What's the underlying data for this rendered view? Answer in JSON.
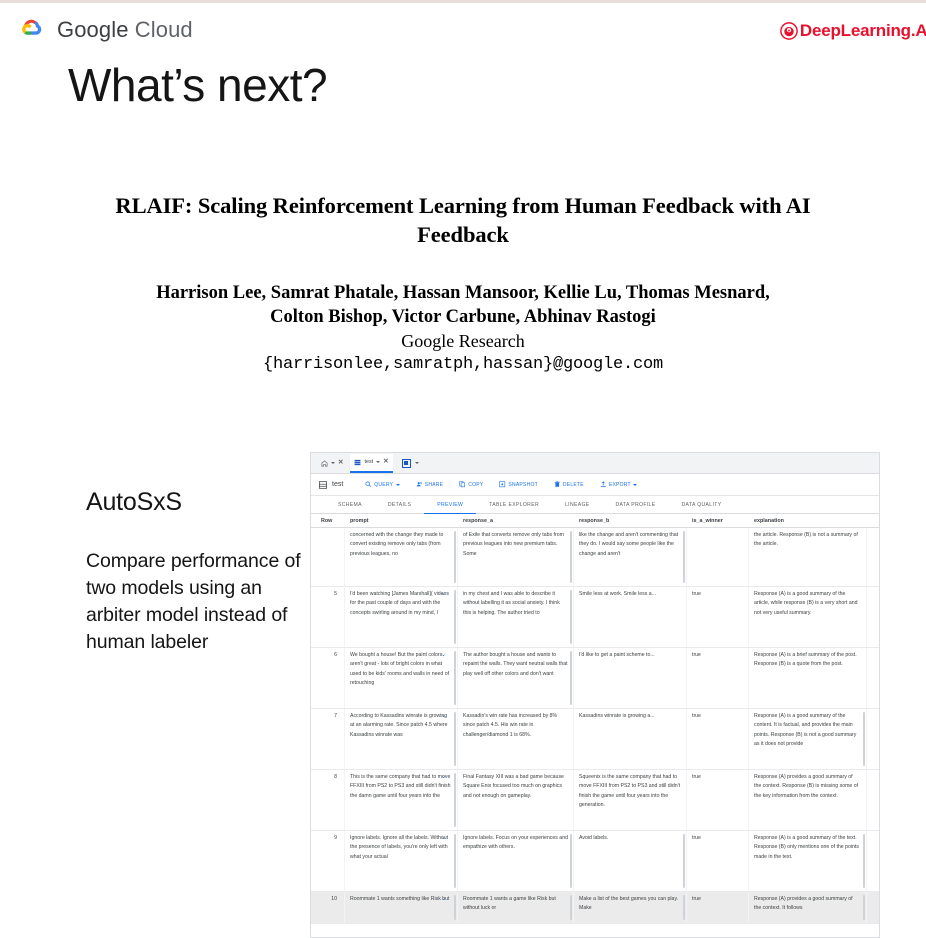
{
  "header": {
    "google_cloud_label_bold": "Google",
    "google_cloud_label_thin": "Cloud",
    "deeplearning_label": "DeepLearning.AI"
  },
  "slide": {
    "title": "What’s next?"
  },
  "paper": {
    "title": "RLAIF: Scaling Reinforcement Learning from Human Feedback with AI Feedback",
    "authors_line1": "Harrison Lee, Samrat Phatale, Hassan Mansoor, Kellie Lu, Thomas Mesnard,",
    "authors_line2": "Colton Bishop, Victor Carbune, Abhinav Rastogi",
    "affiliation": "Google Research",
    "email": "{harrisonlee,samratph,hassan}@google.com"
  },
  "left_column": {
    "heading": "AutoSxS",
    "body": "Compare performance of two models using an arbiter model instead of human labeler"
  },
  "console": {
    "tabstrip": {
      "home_tab_icon": "home-icon",
      "home_tab_caret": "chevron-down-icon",
      "home_tab_close": "✕",
      "table_tab_icon": "table-icon",
      "table_tab_label": "test",
      "table_tab_caret": "chevron-down-icon",
      "table_tab_close": "✕",
      "new_tab_icon": "new-tab-icon",
      "new_tab_caret": "chevron-down-icon"
    },
    "toolbar": {
      "table_icon": "table-icon",
      "table_name": "test",
      "buttons": [
        {
          "label": "QUERY",
          "icon": "search-icon",
          "has_caret": true
        },
        {
          "label": "SHARE",
          "icon": "person-add-icon",
          "has_caret": false
        },
        {
          "label": "COPY",
          "icon": "copy-icon",
          "has_caret": false
        },
        {
          "label": "SNAPSHOT",
          "icon": "snapshot-icon",
          "has_caret": false
        },
        {
          "label": "DELETE",
          "icon": "trash-icon",
          "has_caret": false
        },
        {
          "label": "EXPORT",
          "icon": "export-icon",
          "has_caret": true
        }
      ]
    },
    "section_tabs": [
      {
        "label": "SCHEMA",
        "active": false
      },
      {
        "label": "DETAILS",
        "active": false
      },
      {
        "label": "PREVIEW",
        "active": true
      },
      {
        "label": "TABLE EXPLORER",
        "active": false
      },
      {
        "label": "LINEAGE",
        "active": false
      },
      {
        "label": "DATA PROFILE",
        "active": false
      },
      {
        "label": "DATA QUALITY",
        "active": false
      }
    ],
    "grid": {
      "columns": [
        "Row",
        "prompt",
        "response_a",
        "response_b",
        "is_a_winner",
        "explanation"
      ],
      "rows": [
        {
          "row": "",
          "prompt": "concerned with the change they made to convert existing remove only tabs (from previous leagues, no",
          "response_a": "of Exile that converts remove only tabs from previous leagues into new premium tabs. Some",
          "response_b": "like the change and aren't commenting that they do. I would say some people like the change and aren't",
          "is_a_winner": "",
          "explanation": "the article. Response (B) is not a summary of the article.",
          "clipped_top": true,
          "shaded": false
        },
        {
          "row": "5",
          "prompt": "I'd been watching [James Marshall]( videos for the past couple of days and with the concepts swirling around in my mind, I",
          "response_a": "in my chest and I was able to describe it without labelling it as social anxiety. I think this is helping. The author tried to",
          "response_b": "Smile less at work. Smile less a...",
          "is_a_winner": "true",
          "explanation": "Response (A) is a good summary of the article, while response (B) is a very short and not very useful summary.",
          "clipped_top": false,
          "shaded": false
        },
        {
          "row": "6",
          "prompt": "We bought a house! But the paint colors aren't great - lots of bright colors in what used to be kids' rooms and walls in need of retouching",
          "response_a": "The author bought a house and wants to repaint the walls. They want neutral walls that play well off other colors and don't want",
          "response_b": "I'd like to get a paint scheme to...",
          "is_a_winner": "true",
          "explanation": "Response (A) is a brief summary of the post. Response (B) is a quote from the post.",
          "clipped_top": false,
          "shaded": false
        },
        {
          "row": "7",
          "prompt": "According to  Kassadins winrate is growing at an alarming rate.  Since patch 4.5 where Kassadins winrate was",
          "response_a": "Kassadin's win rate has increased by 8% since patch 4.5. His win rate in challenger/diamond 1 is 68%.",
          "response_b": "Kassadins winrate is growing a...",
          "is_a_winner": "true",
          "explanation": "Response (A) is a good summary of the content. It is factual, and provides the main points. Response (B) is not a good summary as it does not provide",
          "clipped_top": false,
          "shaded": false
        },
        {
          "row": "8",
          "prompt": "This is the same company that had to move FFXIII from PS2 to PS3 and  still didn't finish the damn game until four years into the",
          "response_a": "Final Fantasy XIII was a bad game because Square Enix focused too much on graphics and not enough on gameplay.",
          "response_b": "Squeenix is the same company that had to move FFXIII from PS2 to PS3 and still didn't finish the game until four years into the generation.",
          "is_a_winner": "true",
          "explanation": "Response (A) provides a good summary of the context. Response (B) is missing some of the key information from the context.",
          "clipped_top": false,
          "shaded": false
        },
        {
          "row": "9",
          "prompt": "Ignore labels. Ignore all the labels. Without the presence of labels, you're only left with what your actual",
          "response_a": "Ignore labels. Focus on your experiences and empathize with others.",
          "response_b": "Avoid labels.",
          "is_a_winner": "true",
          "explanation": "Response (A) is a good summary of the text. Response (B) only mentions one of the points made in the text.",
          "clipped_top": false,
          "shaded": false
        },
        {
          "row": "10",
          "prompt": "Roommate 1 wants something like Risk but",
          "response_a": "Roommate 1 wants a game like Risk but without luck or",
          "response_b": "Make a list of the best games you can play. Make",
          "is_a_winner": "true",
          "explanation": "Response (A) provides a good summary of the context. It follows",
          "clipped_top": false,
          "shaded": true
        }
      ]
    }
  },
  "colors": {
    "google_blue": "#1a73e8",
    "dlai_red": "#e8112d",
    "grid_border": "#e8eaed",
    "text_primary": "#3c4043"
  }
}
